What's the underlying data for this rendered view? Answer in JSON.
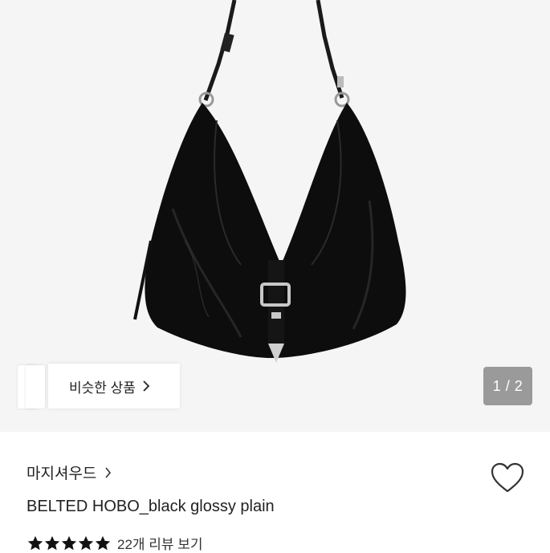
{
  "gallery": {
    "image_alt": "black leather hobo bag with silver belt buckle",
    "counter": "1 / 2",
    "similar_button_label": "비슷한 상품"
  },
  "product": {
    "brand": "마지셔우드",
    "title": "BELTED HOBO_black glossy plain",
    "rating_stars": 5,
    "review_link": "22개 리뷰 보기"
  },
  "icons": {
    "similar_chevron": "chevron-right-icon",
    "brand_chevron": "chevron-right-icon",
    "wishlist": "heart-outline-icon",
    "star": "star-icon"
  },
  "colors": {
    "hero_bg": "#f5f5f5",
    "counter_bg": "#9a9a9a",
    "star": "#111111"
  }
}
